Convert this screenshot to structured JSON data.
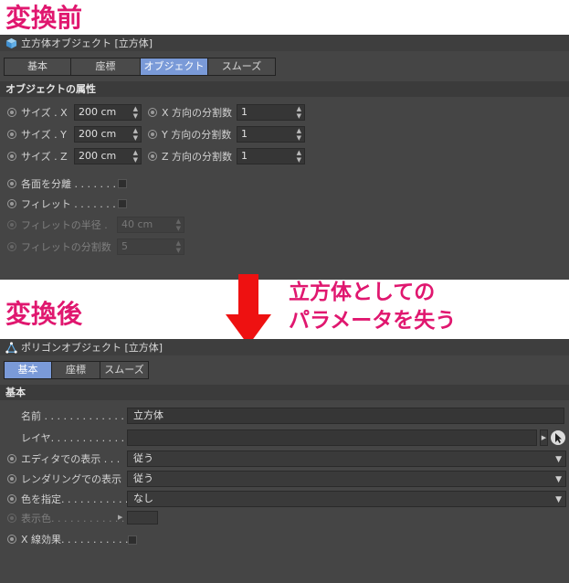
{
  "labels": {
    "before": "変換前",
    "after": "変換後",
    "note_line1": "立方体としての",
    "note_line2": "パラメータを失う"
  },
  "before": {
    "title": "立方体オブジェクト [立方体]",
    "tabs": [
      {
        "label": "基本",
        "active": false
      },
      {
        "label": "座標",
        "active": false
      },
      {
        "label": "オブジェクト",
        "active": true
      },
      {
        "label": "スムーズ",
        "active": false
      }
    ],
    "section": "オブジェクトの属性",
    "size_rows": [
      {
        "label": "サイズ . X",
        "value": "200 cm",
        "seg_label": "X 方向の分割数",
        "seg_value": "1"
      },
      {
        "label": "サイズ . Y",
        "value": "200 cm",
        "seg_label": "Y 方向の分割数",
        "seg_value": "1"
      },
      {
        "label": "サイズ . Z",
        "value": "200 cm",
        "seg_label": "Z 方向の分割数",
        "seg_value": "1"
      }
    ],
    "separate_faces": "各面を分離 . . . . . . .",
    "fillet": "フィレット . . . . . . . .",
    "fillet_radius": {
      "label": "フィレットの半径 .",
      "value": "40 cm"
    },
    "fillet_subdiv": {
      "label": "フィレットの分割数",
      "value": "5"
    }
  },
  "after": {
    "title": "ポリゴンオブジェクト [立方体]",
    "tabs": [
      {
        "label": "基本",
        "active": true
      },
      {
        "label": "座標",
        "active": false
      },
      {
        "label": "スムーズ",
        "active": false
      }
    ],
    "section": "基本",
    "name_label": "名前 . . . . . . . . . . . . . . .",
    "name_value": "立方体",
    "layer_label": "レイヤ. . . . . . . . . . . . . .",
    "layer_value": "",
    "editor_label": "エディタでの表示 . . .",
    "editor_value": "従う",
    "render_label": "レンダリングでの表示",
    "render_value": "従う",
    "color_label": "色を指定. . . . . . . . . . .",
    "color_value": "なし",
    "display_color_label": "表示色. . . . . . . . . . . .",
    "xray_label": "X 線効果. . . . . . . . . . ."
  },
  "colors": {
    "accent": "#e0176f",
    "arrow": "#ee1111",
    "panel_bg": "#454545",
    "tab_active": "#7a9ad8"
  }
}
